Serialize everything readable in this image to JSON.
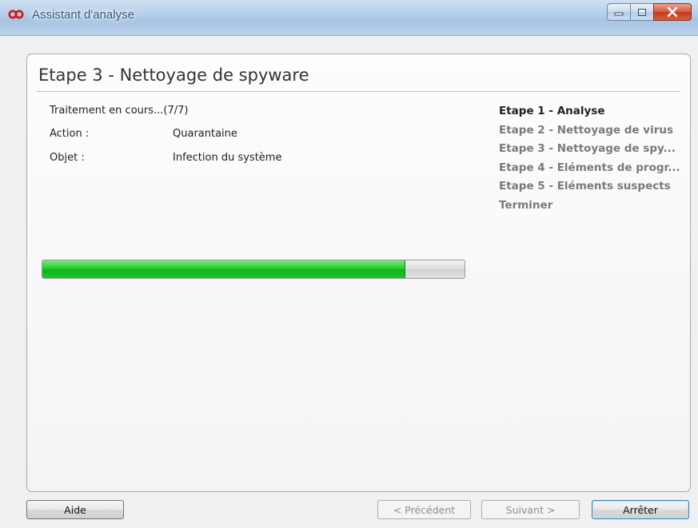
{
  "window": {
    "title": "Assistant d'analyse",
    "logo_icon": "infinity-logo-icon",
    "controls": [
      "minimize-icon",
      "maximize-icon",
      "close-icon"
    ]
  },
  "main": {
    "step_title": "Etape 3 - Nettoyage de spyware",
    "status_label": "Traitement en cours...(7/7)",
    "action_label": "Action :",
    "action_value": "Quarantaine",
    "object_label": "Objet :",
    "object_value": "Infection du système",
    "progress_percent": 86
  },
  "steps": {
    "current_index": 0,
    "items": [
      "Etape 1 - Analyse",
      "Etape 2 - Nettoyage de virus",
      "Etape 3 - Nettoyage de spy...",
      "Etape 4 - Eléments de progr...",
      "Etape 5 - Eléments suspects",
      "Terminer"
    ]
  },
  "footer": {
    "help_label": "Aide",
    "previous_label": "< Précédent",
    "next_label": "Suivant >",
    "stop_label": "Arrêter"
  },
  "colors": {
    "accent_red": "#cc2222",
    "progress_green": "#12bb1f",
    "titlebar_blue": "#b3cde8"
  }
}
